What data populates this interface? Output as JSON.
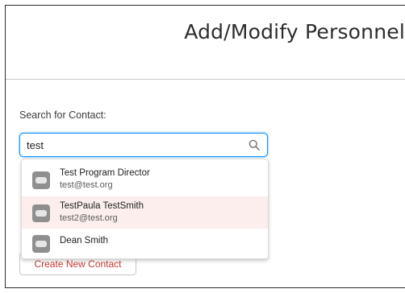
{
  "header": {
    "title": "Add/Modify Personnel"
  },
  "search": {
    "label": "Search for Contact:",
    "value": "test"
  },
  "results": [
    {
      "name": "Test Program Director",
      "email": "test@test.org",
      "highlighted": false
    },
    {
      "name": "TestPaula TestSmith",
      "email": "test2@test.org",
      "highlighted": true
    },
    {
      "name": "Dean Smith",
      "email": "",
      "highlighted": false
    }
  ],
  "actions": {
    "create_label": "Create New Contact"
  },
  "icons": {
    "search": "search-icon",
    "contact": "contact-avatar-icon"
  },
  "colors": {
    "focus": "#1b96ff",
    "link": "#c23934",
    "highlight": "#fbeeec"
  }
}
